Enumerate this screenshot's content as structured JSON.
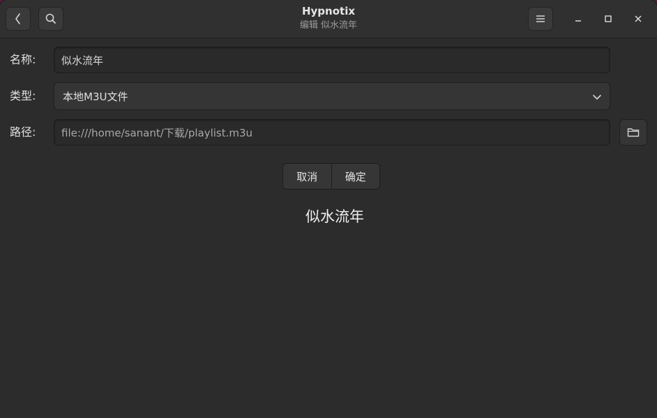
{
  "window": {
    "title": "Hypnotix",
    "subtitle": "编辑 似水流年"
  },
  "headerbar": {
    "back_icon": "chevron-left-icon",
    "search_icon": "search-icon",
    "menu_icon": "hamburger-menu-icon",
    "minimize_icon": "minimize-icon",
    "maximize_icon": "maximize-icon",
    "close_icon": "close-icon"
  },
  "form": {
    "name": {
      "label": "名称:",
      "value": "似水流年"
    },
    "type": {
      "label": "类型:",
      "selected": "本地M3U文件"
    },
    "path": {
      "label": "路径:",
      "value": "file:///home/sanant/下载/playlist.m3u",
      "browse_icon": "folder-icon"
    }
  },
  "actions": {
    "cancel_label": "取消",
    "ok_label": "确定"
  },
  "status": {
    "text": "似水流年"
  },
  "colors": {
    "background": "#2c2c2c",
    "headerbar": "#303030",
    "desktop": "#5a1a3e"
  }
}
